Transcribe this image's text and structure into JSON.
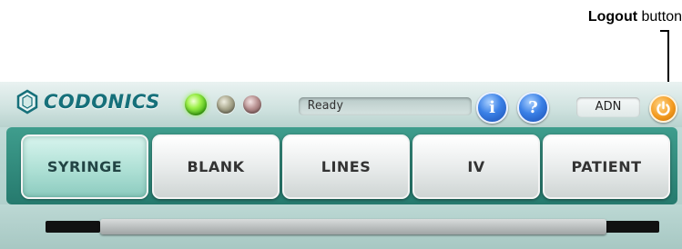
{
  "annotation": {
    "bold": "Logout",
    "rest": " button"
  },
  "header": {
    "brand": "CODONICS",
    "status_text": "Ready",
    "info_label": "i",
    "help_label": "?",
    "user": "ADN"
  },
  "tabs": [
    {
      "label": "SYRINGE",
      "active": true
    },
    {
      "label": "BLANK",
      "active": false
    },
    {
      "label": "LINES",
      "active": false
    },
    {
      "label": "IV",
      "active": false
    },
    {
      "label": "PATIENT",
      "active": false
    }
  ],
  "colors": {
    "brand": "#16707a",
    "tab_bar": "#267a6e",
    "led_active": "#3fae12",
    "logout": "#f39a1f"
  }
}
